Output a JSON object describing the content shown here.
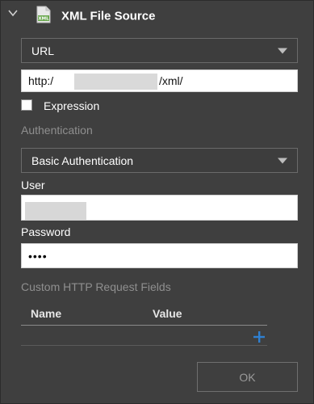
{
  "header": {
    "title": "XML File Source",
    "collapse_icon": "chevron-down-icon",
    "file_icon": "xml-file-icon",
    "file_icon_text": "XML",
    "file_icon_color": "#6aa84f"
  },
  "source_type": {
    "selected": "URL"
  },
  "url": {
    "prefix": "http:/",
    "suffix": "/xml/"
  },
  "expression": {
    "label": "Expression",
    "checked": false
  },
  "authentication": {
    "section_label": "Authentication",
    "selected": "Basic Authentication"
  },
  "user": {
    "label": "User"
  },
  "password": {
    "label": "Password",
    "masked_value": "••••"
  },
  "custom_fields": {
    "section_label": "Custom HTTP Request Fields",
    "columns": [
      "Name",
      "Value"
    ],
    "add_icon": "plus-icon",
    "accent_color": "#2f80d1"
  },
  "ok_button": {
    "label": "OK",
    "enabled": false
  }
}
